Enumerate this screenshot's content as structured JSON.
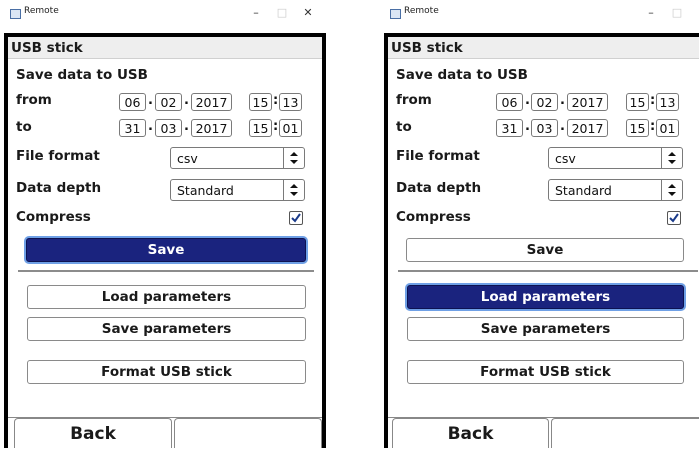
{
  "window_title": "Remote",
  "titlebar": {
    "minimize": "–",
    "maximize": "□",
    "close": "✕"
  },
  "header": "USB stick",
  "section_title": "Save data to USB",
  "from": {
    "label": "from",
    "day": "06",
    "month": "02",
    "year": "2017",
    "hour": "15",
    "minute": "13"
  },
  "to": {
    "label": "to",
    "day": "31",
    "month": "03",
    "year": "2017",
    "hour": "15",
    "minute": "01"
  },
  "date_sep": ".",
  "time_sep": ":",
  "file_format": {
    "label": "File format",
    "value": "csv"
  },
  "data_depth": {
    "label": "Data depth",
    "value": "Standard"
  },
  "compress": {
    "label": "Compress",
    "checked": true
  },
  "buttons": {
    "save": "Save",
    "load_parameters": "Load parameters",
    "save_parameters": "Save parameters",
    "format_usb": "Format USB stick"
  },
  "footer": {
    "back": "Back",
    "right": ""
  },
  "states": {
    "left_active": "save",
    "right_active": "load_parameters"
  },
  "colors": {
    "active_button": "#1a237e",
    "active_glow": "#6fa0e6",
    "check": "#1a3a8a"
  }
}
